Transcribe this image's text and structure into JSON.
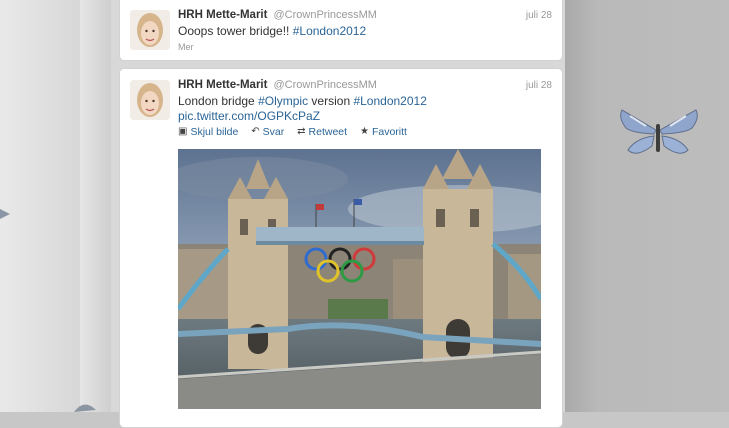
{
  "tweets": [
    {
      "name": "HRH Mette-Marit",
      "handle": "@CrownPrincessMM",
      "date": "juli 28",
      "text_prefix": "Ooops tower bridge!! ",
      "hashtag1": "#London2012",
      "more_label": "Mer"
    },
    {
      "name": "HRH Mette-Marit",
      "handle": "@CrownPrincessMM",
      "date": "juli 28",
      "text_prefix": "London bridge ",
      "hashtag1": "#Olympic",
      "text_middle": " version ",
      "hashtag2": "#London2012",
      "pic_link": "pic.twitter.com/OGPKcPaZ",
      "actions": {
        "hide_photo": "Skjul bilde",
        "reply": "Svar",
        "retweet": "Retweet",
        "favorite": "Favoritt"
      }
    }
  ],
  "icons": {
    "hide_photo": "photo-icon",
    "reply": "reply-arrow-icon",
    "retweet": "retweet-icon",
    "favorite": "star-icon"
  },
  "colors": {
    "link": "#2a6496",
    "name": "#333333",
    "meta": "#999999",
    "background": "#c7c7c7"
  }
}
